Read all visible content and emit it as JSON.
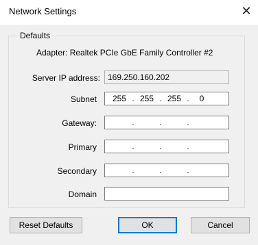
{
  "window": {
    "title": "Network Settings",
    "close_glyph": "✕"
  },
  "group": {
    "label": "Defaults"
  },
  "adapter_text": "Adapter: Realtek PCIe GbE Family Controller #2",
  "fields": {
    "server_ip": {
      "label": "Server IP address:",
      "value": "169.250.160.202"
    },
    "subnet": {
      "label": "Subnet",
      "octets": [
        "255",
        "255",
        "255",
        "0"
      ]
    },
    "gateway": {
      "label": "Gateway:",
      "octets": [
        "",
        "",
        "",
        ""
      ]
    },
    "primary": {
      "label": "Primary",
      "octets": [
        "",
        "",
        "",
        ""
      ]
    },
    "secondary": {
      "label": "Secondary",
      "octets": [
        "",
        "",
        "",
        ""
      ]
    },
    "domain": {
      "label": "Domain",
      "value": ""
    }
  },
  "buttons": {
    "reset": "Reset Defaults",
    "ok": "OK",
    "cancel": "Cancel"
  },
  "colors": {
    "accent": "#0078d7",
    "client_bg": "#f0f0f0"
  }
}
